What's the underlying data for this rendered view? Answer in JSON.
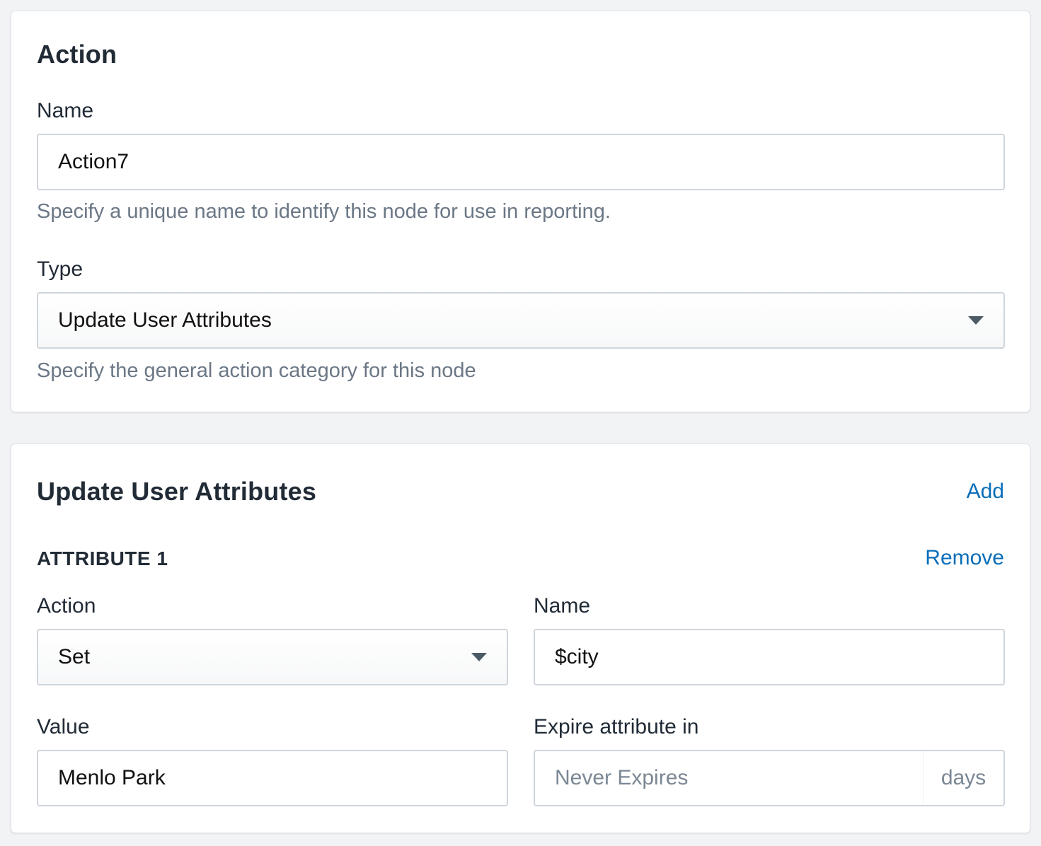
{
  "action_card": {
    "title": "Action",
    "name_label": "Name",
    "name_value": "Action7",
    "name_help": "Specify a unique name to identify this node for use in reporting.",
    "type_label": "Type",
    "type_value": "Update User Attributes",
    "type_help": "Specify the general action category for this node"
  },
  "attributes_card": {
    "title": "Update User Attributes",
    "add_label": "Add",
    "attribute": {
      "heading": "ATTRIBUTE 1",
      "remove_label": "Remove",
      "action_label": "Action",
      "action_value": "Set",
      "name_label": "Name",
      "name_value": "$city",
      "value_label": "Value",
      "value_value": "Menlo Park",
      "expire_label": "Expire attribute in",
      "expire_placeholder": "Never Expires",
      "expire_suffix": "days"
    }
  },
  "colors": {
    "link": "#0a6eb8",
    "help_text": "#6b7785",
    "background": "#f2f3f5"
  }
}
